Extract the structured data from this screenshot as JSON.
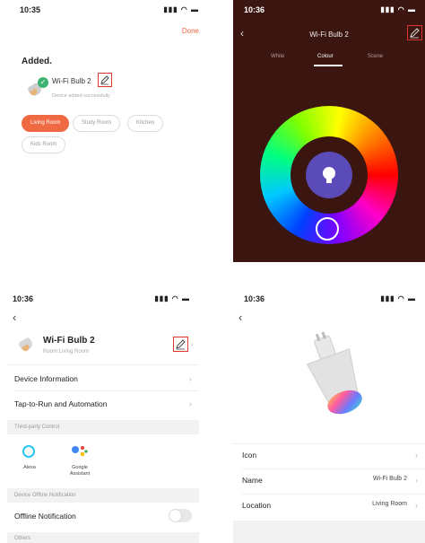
{
  "panel1": {
    "time": "10:35",
    "status_icons": "▮▮▮ ◠ ▬",
    "done": "Done",
    "added": "Added.",
    "device_name": "Wi-Fi Bulb 2",
    "device_sub": "Device added successfully",
    "rooms": [
      "Living Room",
      "Study Room",
      "Kitchen",
      "Kids Room"
    ]
  },
  "panel2": {
    "time": "10:36",
    "status_icons": "▮▮▮ ◠ ▬",
    "title": "Wi-Fi Bulb 2",
    "tabs": [
      "White",
      "Colour",
      "Scene"
    ],
    "bg": "#3b1510",
    "accent": "#5a4bb8"
  },
  "panel3": {
    "time": "10:36",
    "status_icons": "▮▮▮ ◠ ▬",
    "device_name": "Wi-Fi Bulb 2",
    "room": "Room:Living Room",
    "rows": [
      "Device Information",
      "Tap-to-Run and Automation"
    ],
    "third_party_header": "Third-party Control",
    "alexa": "Alexa",
    "google": "Google Assistant",
    "offline_header": "Device Offline Notification",
    "offline_label": "Offline Notification",
    "others_header": "Others"
  },
  "panel4": {
    "time": "10:36",
    "status_icons": "▮▮▮ ◠ ▬",
    "icon_label": "Icon",
    "name_label": "Name",
    "name_value": "Wi-Fi Bulb 2",
    "location_label": "Location",
    "location_value": "Living Room"
  }
}
